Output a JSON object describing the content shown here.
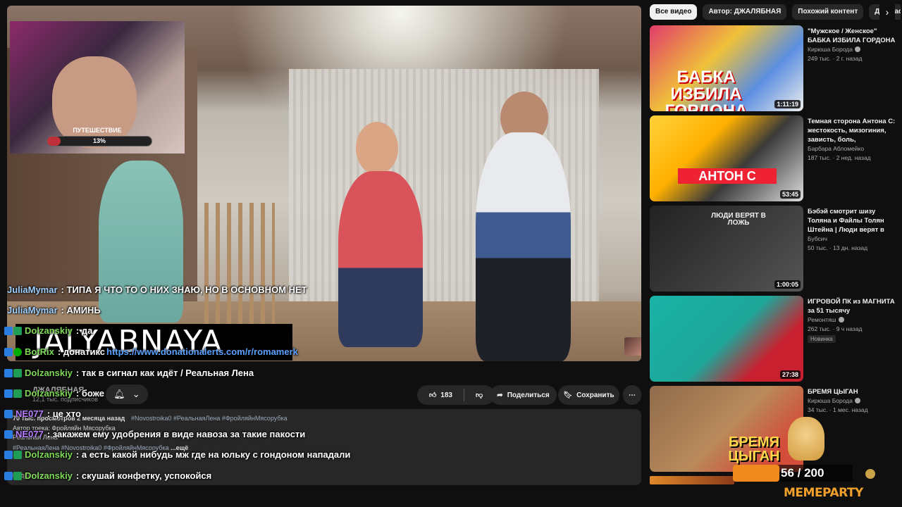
{
  "stream": {
    "cam_label": "ПУТЕШЕСТВИЕ",
    "cam_progress_text": "13%",
    "cam_progress": 0.13,
    "streamer_name": "JALYABNAYA",
    "counter_text": "56 / 200",
    "counter_progress": 0.39,
    "brand": "MEMEPARTY"
  },
  "chat": [
    {
      "user": "JuliaMymar",
      "color": "#9fd0ff",
      "text": ": ТИПА Я ЧТО ТО О НИХ ЗНАЮ, НО В ОСНОВНОМ НЕТ",
      "badges": []
    },
    {
      "user": "JuliaMymar",
      "color": "#9fd0ff",
      "text": ": АМИНЬ",
      "badges": []
    },
    {
      "user": "Dolzanskiy",
      "color": "#7ed957",
      "text": ": да",
      "badges": [
        "blue",
        "green"
      ]
    },
    {
      "user": "BotRix",
      "color": "#7ed957",
      "text": ": донатикс ",
      "link": "https://www.donationalerts.com/r/romamerk",
      "badges": [
        "blue",
        "mod"
      ]
    },
    {
      "user": "Dolzanskiy",
      "color": "#7ed957",
      "text": ": так в сигнал как идёт / Реальная Лена",
      "badges": [
        "blue",
        "green"
      ]
    },
    {
      "user": "Dolzanskiy",
      "color": "#7ed957",
      "text": ": боже",
      "badges": [
        "blue",
        "green"
      ]
    },
    {
      "user": "NE077",
      "color": "#b57cff",
      "text": ": це хто",
      "badges": [
        "blue"
      ]
    },
    {
      "user": "NE077",
      "color": "#b57cff",
      "text": ": закажем ему удобрения в виде навоза за такие пакости",
      "badges": [
        "blue"
      ]
    },
    {
      "user": "Dolzanskiy",
      "color": "#7ed957",
      "text": ": а есть какой нибудь мж где на юльку с гондоном нападали",
      "badges": [
        "blue",
        "green"
      ]
    },
    {
      "user": "Dolzanskiy",
      "color": "#7ed957",
      "text": ": скушай конфетку, успокойся",
      "badges": [
        "blue",
        "green"
      ]
    }
  ],
  "video": {
    "channel": "ДЖАЛЯБНАЯ",
    "subs": "12,1 тыс. подписчиков",
    "likes": "183",
    "share": "Поделиться",
    "save": "Сохранить",
    "stats": "70 тыс. просмотров  2 месяца назад",
    "tags": "#Novostroika0 #РеальнаяЛена #ФройляйнМясорубка",
    "author_line": "Автор трека: Фройляйн Мясорубка",
    "line3": "Реальная Лена",
    "tags2": "#РеальнаяЛена #Novostroika0 #ФройляйнМясорубка",
    "more": "...ещё",
    "bottom_line": "Подписчики ·"
  },
  "chips": [
    "Все видео",
    "Автор: ДЖАЛЯБНАЯ",
    "Похожий контент",
    "Для вас"
  ],
  "related": [
    {
      "title": "\"Мужское / Женское\" БАБКА ИЗБИЛА ГОРДОНА",
      "channel": "Кирюша Борода",
      "meta": "249 тыс. · 2 г. назад",
      "duration": "1:11:19",
      "thumb_text": "БАБКА ИЗБИЛА ГОРДОНА",
      "badge": ""
    },
    {
      "title": "Темная сторона Антона С: жестокость, мизогиния, зависть, боль, одиночеств...",
      "channel": "Барбара Абломейко",
      "meta": "187 тыс. · 2 нед. назад",
      "duration": "53:45",
      "thumb_text": "АНТОН С",
      "badge": ""
    },
    {
      "title": "Бэбэй смотрит шизу Толяна и Файлы Толян Штейна | Люди верят в ложь и судя...",
      "channel": "Бубсич",
      "meta": "50 тыс. · 13 дн. назад",
      "duration": "1:00:05",
      "thumb_text": "ЛЮДИ ВЕРЯТ В ЛОЖЬ",
      "badge": ""
    },
    {
      "title": "ИГРОВОЙ ПК из МАГНИТА за 51 тысячу",
      "channel": "Ремонтяш",
      "meta": "262 тыс. · 9 ч назад",
      "duration": "27:38",
      "thumb_text": "",
      "badge": "Новинка"
    },
    {
      "title": "БРЕМЯ ЦЫГАН",
      "channel": "Кирюша Борода",
      "meta": "34 тыс. · 1 мес. назад",
      "duration": "",
      "thumb_text": "БРЕМЯ ЦЫГАН",
      "badge": ""
    }
  ]
}
